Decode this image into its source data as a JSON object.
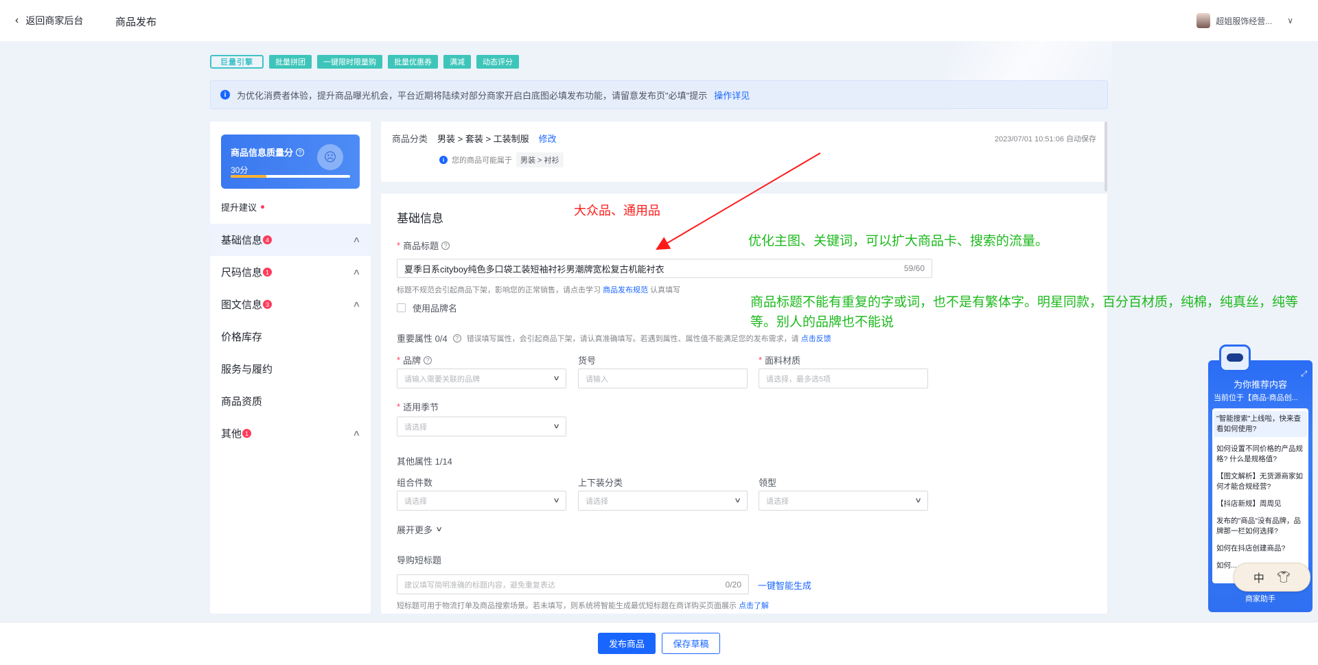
{
  "header": {
    "back_label": "返回商家后台",
    "page_title": "商品发布",
    "shop_name": "超姐服饰经营..."
  },
  "banner": {
    "logo_text": "巨量引擎",
    "tags": [
      "批量拼团",
      "一键限时限量购",
      "批量优惠券",
      "满减",
      "动态评分"
    ]
  },
  "notice": {
    "text": "为优化消费者体验，提升商品曝光机会，平台近期将陆续对部分商家开启白底图必填发布功能，请留意发布页\"必填\"提示",
    "link": "操作详见"
  },
  "sidebar": {
    "score_title": "商品信息质量分",
    "score_value": "30分",
    "score_fraction": 0.3,
    "suggest_label": "提升建议",
    "items": [
      {
        "label": "基础信息",
        "badge": "4"
      },
      {
        "label": "尺码信息",
        "badge": "1"
      },
      {
        "label": "图文信息",
        "badge": "3"
      },
      {
        "label": "价格库存",
        "badge": ""
      },
      {
        "label": "服务与履约",
        "badge": ""
      },
      {
        "label": "商品资质",
        "badge": ""
      },
      {
        "label": "其他",
        "badge": "1"
      }
    ]
  },
  "category": {
    "label": "商品分类",
    "path": "男装 > 套装 > 工装制服",
    "edit": "修改",
    "hint": "您的商品可能属于",
    "suggest": "男装 > 衬衫",
    "autosave": "2023/07/01 10:51:06 自动保存"
  },
  "form": {
    "section_title": "基础信息",
    "title_label": "商品标题",
    "title_value": "夏季日系cityboy纯色多口袋工装短袖衬衫男潮牌宽松复古机能衬衣",
    "title_count": "59/60",
    "title_hint": "标题不规范会引起商品下架，影响您的正常销售，请点击学习",
    "title_hint_link": "商品发布规范",
    "title_hint_tail": "认真填写",
    "use_brand": "使用品牌名",
    "important_attrs": "重要属性 0/4",
    "important_hint": "错误填写属性，会引起商品下架，请认真准确填写。若遇到属性、属性值不能满足您的发布需求，请",
    "important_hint_link": "点击反馈",
    "brand_label": "品牌",
    "brand_placeholder": "请输入需要关联的品牌",
    "sku_label": "货号",
    "sku_placeholder": "请输入",
    "fabric_label": "面料材质",
    "fabric_placeholder": "请选择，最多选5项",
    "season_label": "适用季节",
    "season_placeholder": "请选择",
    "other_attrs": "其他属性 1/14",
    "combo_label": "组合件数",
    "combo_placeholder": "请选择",
    "updown_label": "上下装分类",
    "updown_placeholder": "请选择",
    "collar_label": "领型",
    "collar_placeholder": "请选择",
    "expand_more": "展开更多",
    "short_title_label": "导购短标题",
    "short_title_placeholder": "建议填写简明准确的标题内容，避免重复表达",
    "short_title_count": "0/20",
    "smart_generate": "一键智能生成",
    "short_hint": "短标题可用于物流打单及商品搜索场景。若未填写，则系统将智能生成最优短标题在商详购买页面展示",
    "short_hint_link": "点击了解"
  },
  "annotations": {
    "red": "大众品、通用品",
    "green1": "优化主图、关键词，可以扩大商品卡、搜索的流量。",
    "green2": "商品标题不能有重复的字或词，也不是有繁体字。明星同款，百分百材质，纯棉，纯真丝，纯等等。别人的品牌也不能说"
  },
  "assistant": {
    "title": "为你推荐内容",
    "subtitle": "当前位于【商品-商品创...",
    "questions": [
      "\"智能搜索\"上线啦，快来查看如何使用?",
      "如何设置不同价格的产品规格? 什么是规格值?",
      "【图文解析】无货源商家如何才能合规经营?",
      "【抖店新规】周周见",
      "发布的\"商品\"没有品牌，品牌那一栏如何选择?",
      "如何在抖店创建商品?",
      "如何..."
    ],
    "footer": "商家助手"
  },
  "ime": {
    "lang": "中"
  },
  "footer": {
    "publish": "发布商品",
    "draft": "保存草稿"
  },
  "colors": {
    "primary": "#1966ff",
    "danger": "#ff3b5c",
    "annotation_red": "#ff1a1a",
    "annotation_green": "#1db91d",
    "tag": "#3ec5ba"
  }
}
